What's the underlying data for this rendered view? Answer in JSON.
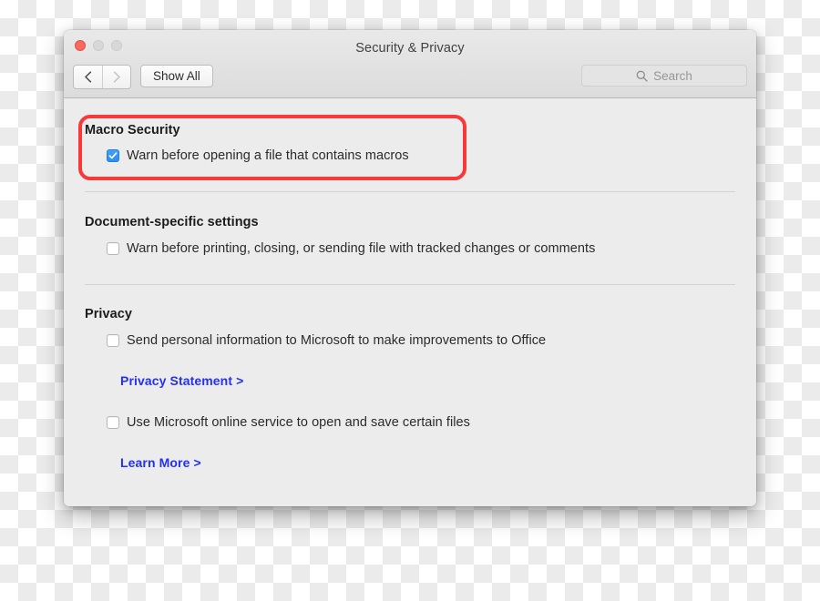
{
  "window": {
    "title": "Security & Privacy",
    "traffic_lights": [
      "close-button",
      "minimize-button",
      "zoom-button"
    ]
  },
  "toolbar": {
    "back_icon": "chevron-left-icon",
    "forward_icon": "chevron-right-icon",
    "show_all_label": "Show All",
    "search": {
      "icon": "search-icon",
      "placeholder": "Search",
      "value": ""
    }
  },
  "sections": [
    {
      "id": "macro-security",
      "title": "Macro Security",
      "highlighted": true,
      "rows": [
        {
          "type": "checkbox",
          "checked": true,
          "label": "Warn before opening a file that contains macros"
        }
      ]
    },
    {
      "id": "document-specific-settings",
      "title": "Document-specific settings",
      "highlighted": false,
      "rows": [
        {
          "type": "checkbox",
          "checked": false,
          "label": "Warn before printing, closing, or sending file with tracked changes or comments"
        }
      ]
    },
    {
      "id": "privacy",
      "title": "Privacy",
      "highlighted": false,
      "rows": [
        {
          "type": "checkbox",
          "checked": false,
          "label": "Send personal information to Microsoft to make improvements to Office"
        },
        {
          "type": "link",
          "label": "Privacy Statement >"
        },
        {
          "type": "checkbox",
          "checked": false,
          "label": "Use Microsoft online service to open and save certain files"
        },
        {
          "type": "link",
          "label": "Learn More >"
        }
      ]
    }
  ],
  "colors": {
    "accent_checkbox": "#2b8ef0",
    "link": "#2431f0",
    "annotation_highlight": "#f8393a",
    "close_light": "#f9695f",
    "inactive_light": "#d8d8d8",
    "window_background": "#ececec"
  }
}
